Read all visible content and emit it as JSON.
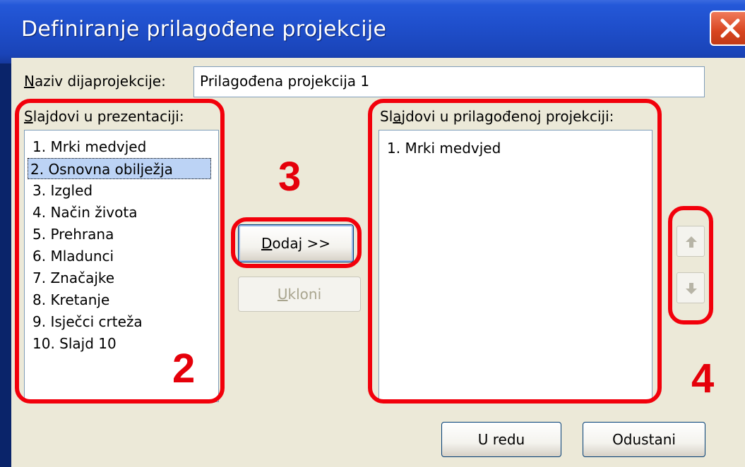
{
  "dialog": {
    "title": "Definiranje prilagođene projekcije",
    "name_label_underlined": "N",
    "name_label_rest": "aziv dijaprojekcije:",
    "name_value": "Prilagođena projekcija 1"
  },
  "left_list": {
    "label_underlined": "S",
    "label_rest": "lajdovi u prezentaciji:",
    "items": [
      "1. Mrki medvjed",
      "2. Osnovna obilježja",
      "3. Izgled",
      "4. Način života",
      "5. Prehrana",
      "6. Mladunci",
      "7. Značajke",
      "8. Kretanje",
      "9. Isječci crteža",
      "10. Slajd 10"
    ],
    "selected_index": 1
  },
  "right_list": {
    "label_pre": "Sl",
    "label_underlined": "a",
    "label_rest": "jdovi u prilagođenoj projekciji:",
    "items": [
      "1. Mrki medvjed"
    ]
  },
  "buttons": {
    "add_underlined": "D",
    "add_rest": "odaj >>",
    "remove_underlined": "U",
    "remove_rest": "kloni",
    "ok": "U redu",
    "cancel": "Odustani"
  },
  "callouts": {
    "left": "2",
    "middle": "3",
    "right": "4"
  },
  "colors": {
    "callout": "#f2000b",
    "titlebar": "#1f4fcc",
    "dialog_bg": "#ece9d8"
  },
  "icons": {
    "close": "close-icon",
    "up": "arrow-up-icon",
    "down": "arrow-down-icon"
  }
}
